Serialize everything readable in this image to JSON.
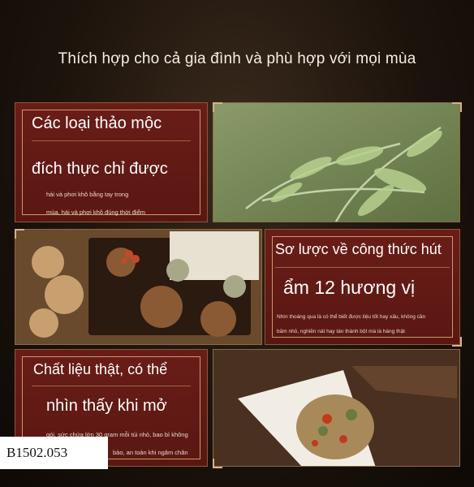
{
  "header": {
    "title": "Thích hợp cho cả gia đình và phù hợp với mọi mùa"
  },
  "panel1": {
    "line1": "Các loại thảo mộc",
    "line2": "đích thực chỉ được",
    "sub1": "hái và phơi khô bằng tay trong",
    "sub2": "mùa, hái và phơi khô đúng thời điểm"
  },
  "panel2": {
    "line1": "Sơ lược về công thức hút",
    "line2": "ẩm 12 hương vị",
    "sub1": "Nhìn thoáng qua là có thể biết được liệu tốt hay xấu, không cần",
    "sub2": "băm nhỏ, nghiền nát hay tán thành bột mà là hàng thật"
  },
  "panel3": {
    "line1": "Chất liệu thật, có thể",
    "line2": "nhìn thấy khi mở",
    "sub1": "gói, sức chứa lớn 30 gram mỗi túi nhỏ, bao bì không",
    "sub2": "bảo, an toàn khi ngâm chân"
  },
  "label": {
    "code": "B1502.053"
  },
  "colors": {
    "panel_red": "#5f1914",
    "gold_border": "#c89b6a",
    "background": "#1c130c"
  },
  "icons": [
    "corner-ornament-icon"
  ]
}
